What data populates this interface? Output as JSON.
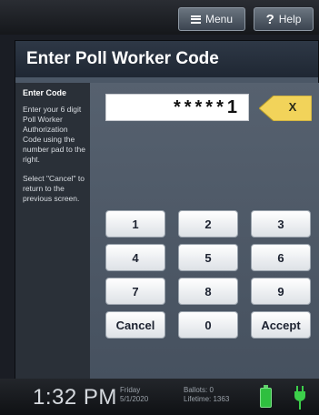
{
  "toolbar": {
    "menu_label": "Menu",
    "help_label": "Help",
    "help_glyph": "?"
  },
  "page": {
    "title": "Enter Poll Worker Code"
  },
  "sidebar": {
    "heading": "Enter Code",
    "instruction": "Enter your 6 digit Poll Worker Authorization Code using the number pad to the right.",
    "cancel_hint": "Select \"Cancel\" to return to the previous screen."
  },
  "code_entry": {
    "display": "*****1",
    "backspace_label": "X",
    "backspace_color": "#f2d35a"
  },
  "keypad": {
    "keys": [
      "1",
      "2",
      "3",
      "4",
      "5",
      "6",
      "7",
      "8",
      "9",
      "Cancel",
      "0",
      "Accept"
    ]
  },
  "status": {
    "time": "1:32 PM",
    "day": "Friday",
    "date": "5/1/2020",
    "ballots_label": "Ballots:",
    "ballots_value": "0",
    "lifetime_label": "Lifetime:",
    "lifetime_value": "1363"
  },
  "colors": {
    "title_bar": "#1f2733",
    "panel": "#4b5766",
    "battery": "#2fbf3f",
    "plug": "#3ccf4a"
  }
}
